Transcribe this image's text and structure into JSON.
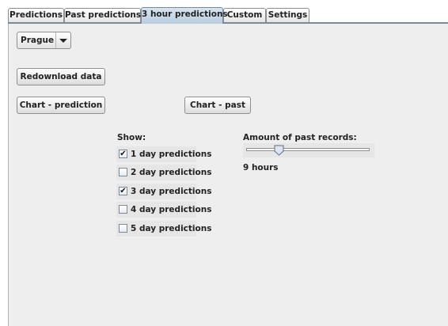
{
  "tabs": [
    {
      "label": "Predictions",
      "active": false
    },
    {
      "label": "Past predictions",
      "active": false
    },
    {
      "label": "3 hour predictions",
      "active": true
    },
    {
      "label": "Custom",
      "active": false
    },
    {
      "label": "Settings",
      "active": false
    }
  ],
  "city_select": {
    "value": "Prague",
    "icon": "chevron-down-icon"
  },
  "buttons": {
    "redownload": "Redownload data",
    "chart_prediction": "Chart - prediction",
    "chart_past": "Chart - past"
  },
  "show": {
    "label": "Show:",
    "options": [
      {
        "label": "1 day predictions",
        "checked": true
      },
      {
        "label": "2 day predictions",
        "checked": false
      },
      {
        "label": "3 day predictions",
        "checked": true
      },
      {
        "label": "4 day predictions",
        "checked": false
      },
      {
        "label": "5 day predictions",
        "checked": false
      }
    ]
  },
  "past_records": {
    "label": "Amount of past records:",
    "slider_fraction": 0.26,
    "value_text": "9 hours"
  },
  "colors": {
    "active_tab": "#c6d7e8",
    "panel": "#eeeeee",
    "accent_border": "#7a8a99"
  }
}
